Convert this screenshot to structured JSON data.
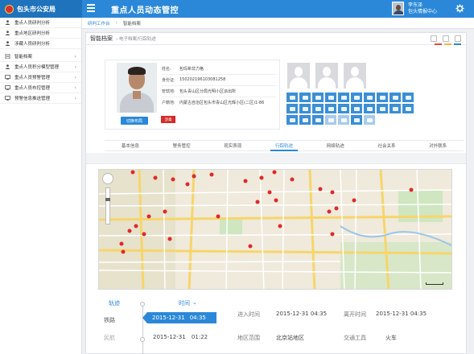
{
  "app": {
    "brand": "包头市公安局",
    "title": "重点人员动态管控",
    "user_name": "李东泽",
    "user_org": "包头情报中心",
    "theme_color": "#2b88d8"
  },
  "sidebar": {
    "items": [
      {
        "label": "重点人员研判分析",
        "icon": "user-icon"
      },
      {
        "label": "重点地区研判分析",
        "icon": "user-icon"
      },
      {
        "label": "涉藏人员研判分析",
        "icon": "user-icon"
      },
      {
        "label": "智能档案",
        "icon": "document-icon"
      },
      {
        "label": "重点人员积分模型管理",
        "icon": "user-icon"
      },
      {
        "label": "重点人员预警管理",
        "icon": "monitor-icon"
      },
      {
        "label": "重点人员布控管理",
        "icon": "monitor-icon"
      },
      {
        "label": "预警信息推送管理",
        "icon": "monitor-icon"
      }
    ]
  },
  "breadcrumb": {
    "tab1": "研判工作台",
    "tab2": "智能档案"
  },
  "panel": {
    "title": "智能档案",
    "path": "› 电子档案/行踪轨迹"
  },
  "profile": {
    "fields": [
      {
        "label": "姓名:",
        "value": "包玛希非力格"
      },
      {
        "label": "身份证:",
        "value": "150202196103081258"
      },
      {
        "label": "管辖地:",
        "value": "包头青山区分局光明小区派出所"
      },
      {
        "label": "户籍地:",
        "value": "内蒙古自治区包头市青山区光辉小区(二区)1-86"
      }
    ],
    "switch_label": "切换布局",
    "badge": "涉毒"
  },
  "tabs": [
    "基本信息",
    "警务管控",
    "现实表现",
    "行踪轨迹",
    "网络轨迹",
    "社会关系",
    "对外联系"
  ],
  "active_tab": "行踪轨迹",
  "timeline": {
    "header_traj": "轨迹",
    "header_time": "时间",
    "entries": [
      {
        "type": "铁路",
        "date": "2015-12-31",
        "time": "04:35",
        "enter_label": "进入时间",
        "enter_value": "2015-12-31 04:35",
        "leave_label": "离开时间",
        "leave_value": "2015-12-31 04:35"
      },
      {
        "type": "民航",
        "date": "2015-12-31",
        "time": "01:22",
        "region_label": "地区范围",
        "region_value": "北京站地区",
        "transport_label": "交通工具",
        "transport_value": "火车"
      }
    ]
  }
}
